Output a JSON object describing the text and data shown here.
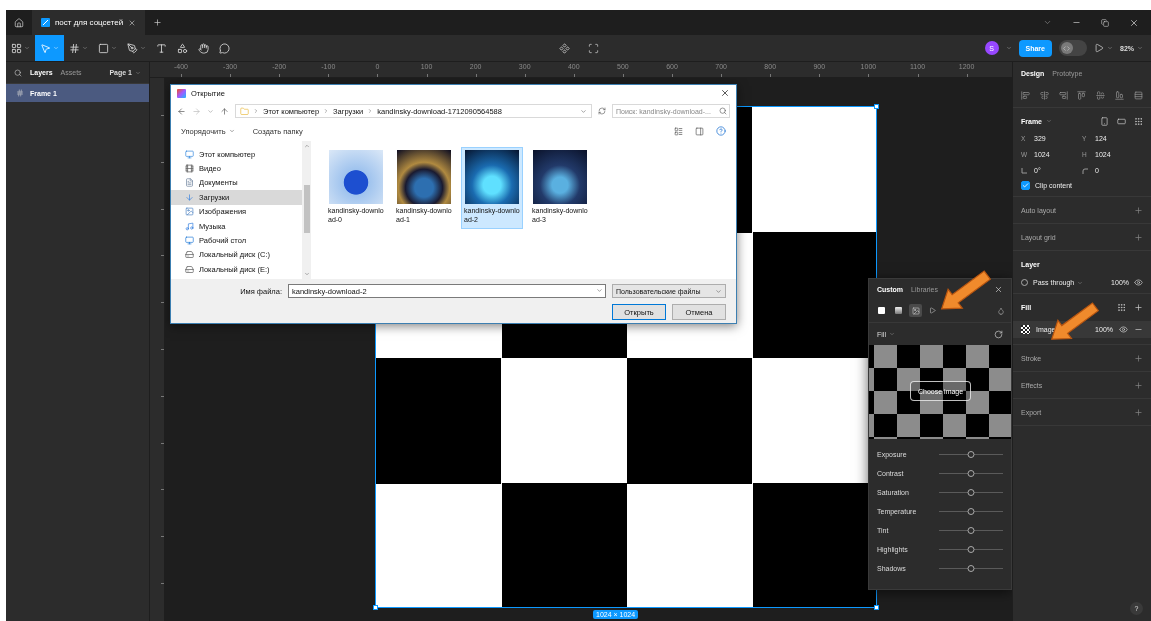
{
  "title_bar": {
    "tabs": [
      {
        "title": "пост для соцсетей",
        "selected": true
      }
    ]
  },
  "toolbar": {
    "tools": [
      {
        "kind": "main-menu",
        "selected": false
      },
      {
        "kind": "move",
        "selected": true
      },
      {
        "kind": "frame",
        "selected": false
      },
      {
        "kind": "shape",
        "selected": false
      },
      {
        "kind": "pen",
        "selected": false
      },
      {
        "kind": "text",
        "selected": false
      },
      {
        "kind": "resources",
        "selected": false
      },
      {
        "kind": "hand",
        "selected": false
      },
      {
        "kind": "comment",
        "selected": false
      }
    ],
    "avatar_initial": "S",
    "share_label": "Share",
    "dev_mode": {
      "on": false
    },
    "zoom": "82%"
  },
  "layers_panel": {
    "tabs": [
      {
        "label": "Layers",
        "selected": true
      },
      {
        "label": "Assets",
        "selected": false
      }
    ],
    "page": "Page 1",
    "layers": [
      {
        "name": "Frame 1",
        "selected": true
      }
    ]
  },
  "ruler": {
    "labels": [
      "-400",
      "-300",
      "-200",
      "-100",
      "0",
      "100",
      "200",
      "300",
      "400",
      "500",
      "600",
      "700",
      "800",
      "900",
      "1000",
      "1100",
      "1200"
    ]
  },
  "canvas": {
    "frame_size": "1024 × 1024"
  },
  "dialog": {
    "title": "Открытие",
    "path": [
      "Этот компьютер",
      "Загрузки",
      "kandinsky-download-1712090564588"
    ],
    "search_placeholder": "Поиск: kandinsky-download-...",
    "commands": [
      "Упорядочить",
      "Создать папку"
    ],
    "nav": [
      {
        "label": "Этот компьютер",
        "kind": "computer",
        "selected": false
      },
      {
        "label": "Видео",
        "kind": "video",
        "selected": false
      },
      {
        "label": "Документы",
        "kind": "documents",
        "selected": false
      },
      {
        "label": "Загрузки",
        "kind": "downloads",
        "selected": true
      },
      {
        "label": "Изображения",
        "kind": "pictures",
        "selected": false
      },
      {
        "label": "Музыка",
        "kind": "music",
        "selected": false
      },
      {
        "label": "Рабочий стол",
        "kind": "desktop",
        "selected": false
      },
      {
        "label": "Локальный диск (C:)",
        "kind": "drive",
        "selected": false
      },
      {
        "label": "Локальный диск (E:)",
        "kind": "drive",
        "selected": false
      }
    ],
    "files": [
      {
        "name": "kandinsky-download-0",
        "selected": false
      },
      {
        "name": "kandinsky-download-1",
        "selected": false
      },
      {
        "name": "kandinsky-download-2",
        "selected": true
      },
      {
        "name": "kandinsky-download-3",
        "selected": false
      }
    ],
    "file_name_label": "Имя файла:",
    "file_name": "kandinsky-download-2",
    "file_type": "Пользовательские файлы",
    "buttons": [
      {
        "label": "Открыть",
        "kind": "primary"
      },
      {
        "label": "Отмена",
        "kind": "secondary"
      }
    ]
  },
  "fill_popup": {
    "tabs": [
      {
        "label": "Custom",
        "selected": true
      },
      {
        "label": "Libraries",
        "selected": false
      }
    ],
    "fill_types": [
      {
        "kind": "solid",
        "selected": false
      },
      {
        "kind": "gradient",
        "selected": false
      },
      {
        "kind": "image",
        "selected": true
      },
      {
        "kind": "video",
        "selected": false
      }
    ],
    "mode": "Fill",
    "choose_label": "Choose image",
    "adjustments": [
      {
        "name": "Exposure",
        "level": 0.5
      },
      {
        "name": "Contrast",
        "level": 0.5
      },
      {
        "name": "Saturation",
        "level": 0.5
      },
      {
        "name": "Temperature",
        "level": 0.5
      },
      {
        "name": "Tint",
        "level": 0.5
      },
      {
        "name": "Highlights",
        "level": 0.5
      },
      {
        "name": "Shadows",
        "level": 0.5
      }
    ]
  },
  "design_panel": {
    "tabs": [
      {
        "label": "Design",
        "selected": true
      },
      {
        "label": "Prototype",
        "selected": false
      }
    ],
    "frame_title": "Frame",
    "fields": [
      {
        "kind": "text",
        "label": "X",
        "value": "329"
      },
      {
        "kind": "text",
        "label": "Y",
        "value": "124"
      },
      {
        "kind": "text",
        "label": "W",
        "value": "1024"
      },
      {
        "kind": "text",
        "label": "H",
        "value": "1024"
      },
      {
        "kind": "rotation",
        "value": "0°"
      },
      {
        "kind": "radius",
        "value": "0"
      }
    ],
    "clip_content": {
      "label": "Clip content",
      "checked": true
    },
    "sections_top": [
      "Auto layout",
      "Layout grid"
    ],
    "layer": {
      "title": "Layer",
      "blend": "Pass through",
      "opacity": "100%"
    },
    "fill": {
      "title": "Fill",
      "fills": [
        {
          "type": "Image",
          "opacity": "100%"
        }
      ]
    },
    "sections_bottom": [
      "Stroke",
      "Effects",
      "Export"
    ],
    "help_label": "?"
  }
}
